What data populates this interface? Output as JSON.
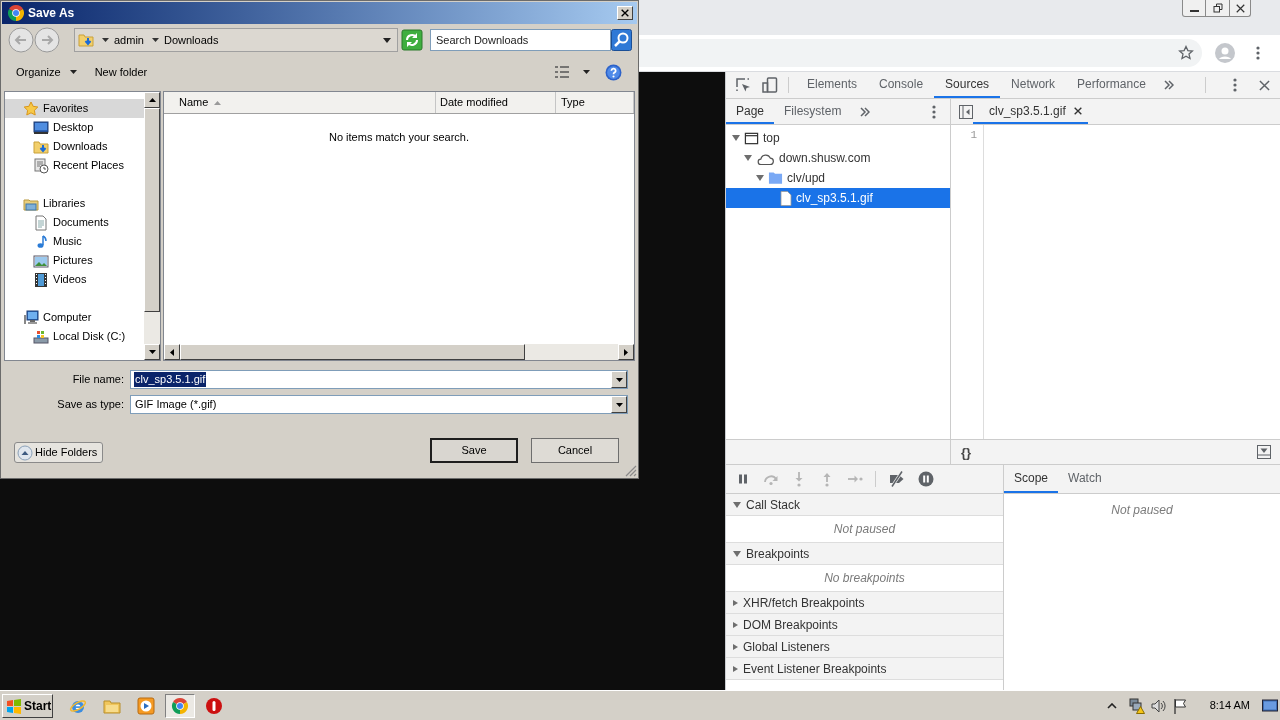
{
  "save_dialog": {
    "title": "Save As",
    "breadcrumb": [
      "admin",
      "Downloads"
    ],
    "search": {
      "placeholder": "Search Downloads"
    },
    "toolbar": [
      {
        "label": "Organize",
        "dropdown": true
      },
      {
        "label": "New folder",
        "dropdown": false
      }
    ],
    "nav_tree": [
      {
        "label": "Favorites",
        "kind": "favorites",
        "selected": true,
        "children": [
          {
            "label": "Desktop",
            "kind": "desktop",
            "selected": false
          },
          {
            "label": "Downloads",
            "kind": "downloads",
            "selected": false
          },
          {
            "label": "Recent Places",
            "kind": "recent",
            "selected": false
          }
        ]
      },
      {
        "label": "Libraries",
        "kind": "libraries",
        "selected": false,
        "children": [
          {
            "label": "Documents",
            "kind": "documents",
            "selected": false
          },
          {
            "label": "Music",
            "kind": "music",
            "selected": false
          },
          {
            "label": "Pictures",
            "kind": "pictures",
            "selected": false
          },
          {
            "label": "Videos",
            "kind": "videos",
            "selected": false
          }
        ]
      },
      {
        "label": "Computer",
        "kind": "computer",
        "selected": false,
        "children": [
          {
            "label": "Local Disk (C:)",
            "kind": "drive",
            "selected": false
          }
        ]
      }
    ],
    "columns": [
      {
        "label": "Name",
        "sorted": true
      },
      {
        "label": "Date modified",
        "sorted": false
      },
      {
        "label": "Type",
        "sorted": false
      }
    ],
    "empty_message": "No items match your search.",
    "fields": [
      {
        "label": "File name:",
        "value": "clv_sp3.5.1.gif",
        "highlighted": true
      },
      {
        "label": "Save as type:",
        "value": "GIF Image (*.gif)",
        "highlighted": false
      }
    ],
    "hide_folders": "Hide Folders",
    "buttons": [
      {
        "label": "Save",
        "default": true
      },
      {
        "label": "Cancel",
        "default": false
      }
    ]
  },
  "devtools": {
    "tabs": [
      {
        "label": "Elements",
        "selected": false
      },
      {
        "label": "Console",
        "selected": false
      },
      {
        "label": "Sources",
        "selected": true
      },
      {
        "label": "Network",
        "selected": false
      },
      {
        "label": "Performance",
        "selected": false
      }
    ],
    "navigator": {
      "tabs": [
        {
          "label": "Page",
          "selected": true
        },
        {
          "label": "Filesystem",
          "selected": false
        }
      ],
      "tree": [
        {
          "label": "top",
          "kind": "frame",
          "selected": false,
          "expanded": true,
          "children": [
            {
              "label": "down.shusw.com",
              "kind": "domain",
              "selected": false,
              "expanded": true,
              "children": [
                {
                  "label": "clv/upd",
                  "kind": "folder",
                  "selected": false,
                  "expanded": true,
                  "children": [
                    {
                      "label": "clv_sp3.5.1.gif",
                      "kind": "file",
                      "selected": true
                    }
                  ]
                }
              ]
            }
          ]
        }
      ]
    },
    "editor": {
      "tabs": [
        {
          "label": "clv_sp3.5.1.gif",
          "selected": true
        }
      ],
      "line_numbers": [
        "1"
      ],
      "pretty_print": "{}"
    },
    "debugger": {
      "sections": [
        {
          "title": "Call Stack",
          "expanded": true,
          "message": "Not paused"
        },
        {
          "title": "Breakpoints",
          "expanded": true,
          "message": "No breakpoints"
        },
        {
          "title": "XHR/fetch Breakpoints",
          "expanded": false
        },
        {
          "title": "DOM Breakpoints",
          "expanded": false
        },
        {
          "title": "Global Listeners",
          "expanded": false
        },
        {
          "title": "Event Listener Breakpoints",
          "expanded": false
        }
      ],
      "side_tabs": [
        {
          "label": "Scope",
          "selected": true
        },
        {
          "label": "Watch",
          "selected": false
        }
      ],
      "side_message": "Not paused"
    }
  },
  "taskbar": {
    "start": "Start",
    "apps": [
      {
        "kind": "ie",
        "selected": false
      },
      {
        "kind": "explorer",
        "selected": false
      },
      {
        "kind": "media",
        "selected": false
      },
      {
        "kind": "chrome",
        "selected": true
      },
      {
        "kind": "stop",
        "selected": false
      }
    ],
    "clock": "8:14 AM"
  }
}
